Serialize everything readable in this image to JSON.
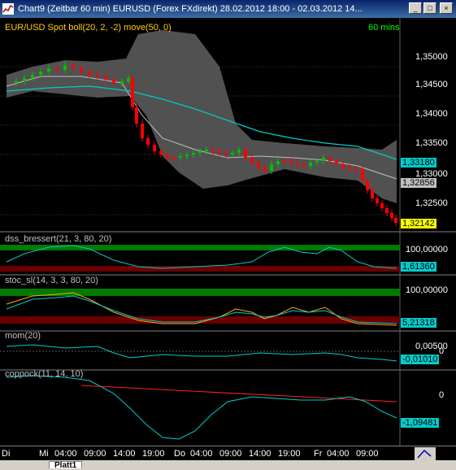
{
  "window": {
    "title": "Chart9 (Zeitbar 60 min)  EURUSD (Forex FXdirekt) 28.02.2012 18:00 - 02.03.2012 14...",
    "min_label": "_",
    "max_label": "□",
    "close_label": "×"
  },
  "main_pane": {
    "legend": "EUR/USD Spot boll(20, 2, -2) move(50, 0)",
    "timeframe": "60 mins",
    "y_ticks": [
      "1,35000",
      "1,34500",
      "1,34000",
      "1,33500",
      "1,33000",
      "1,32500"
    ],
    "badges": [
      {
        "text": "1,33180",
        "color": "#00cccc"
      },
      {
        "text": "1,32856",
        "color": "#c0c0c0"
      },
      {
        "text": "1,32142",
        "color": "#ffff00"
      }
    ]
  },
  "pane_dss": {
    "label": "dss_bressert(21, 3, 80, 20)",
    "y_tick": "100,00000",
    "badge": "1,61360"
  },
  "pane_stoc": {
    "label": "stoc_sl(14, 3, 3, 80, 20)",
    "y_tick": "100,00000",
    "badge": "5,21318"
  },
  "pane_mom": {
    "label": "mom(20)",
    "y_ticks": [
      "0,00500",
      "0"
    ],
    "badge": "-0,01010"
  },
  "pane_coppock": {
    "label": "coppock(11, 14, 10)",
    "y_tick": "0",
    "badge": "-1,09481"
  },
  "x_axis": {
    "labels": [
      "Di",
      "Mi",
      "04:00",
      "09:00",
      "14:00",
      "19:00",
      "Do",
      "04:00",
      "09:00",
      "14:00",
      "19:00",
      "Fr",
      "04:00",
      "09:00"
    ]
  },
  "status": {
    "tab_label": "Platt1"
  },
  "colors": {
    "bull": "#00c000",
    "bear": "#ff0000",
    "band": "#808080",
    "ma": "#00cccc",
    "green_zone": "#007a00",
    "red_zone": "#6a0000"
  }
}
